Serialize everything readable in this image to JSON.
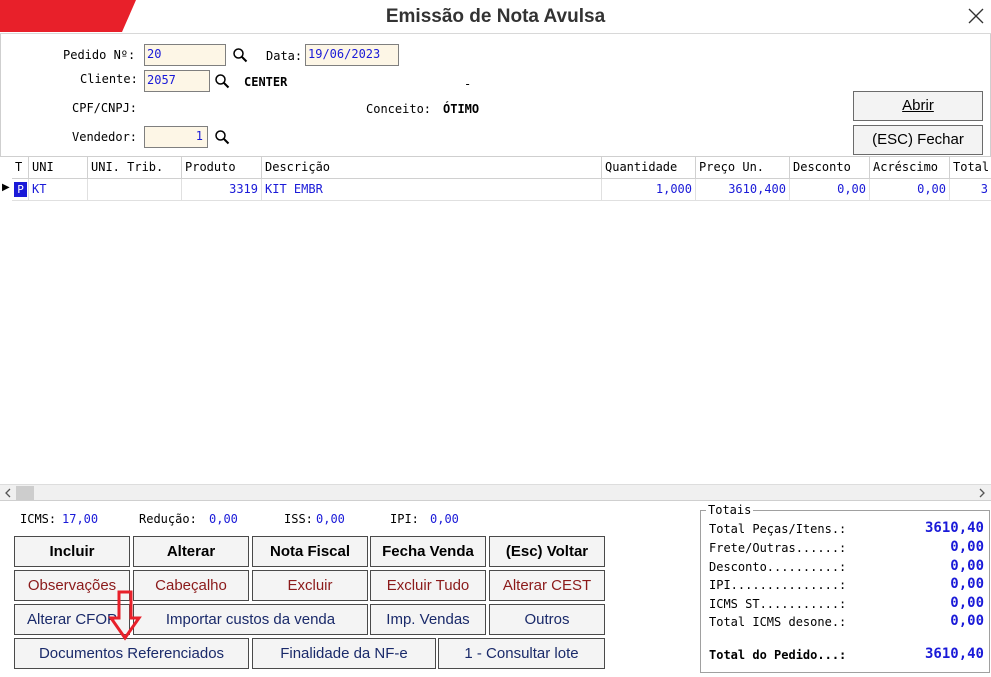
{
  "window": {
    "title": "Emissão de Nota Avulsa",
    "close_icon": "close-icon",
    "accent_color": "#e8202a"
  },
  "header": {
    "pedido_label": "Pedido Nº:",
    "pedido_value": "20",
    "data_label": "Data:",
    "data_value": "19/06/2023",
    "cliente_label": "Cliente:",
    "cliente_value": "2057",
    "cliente_name": "CENTER",
    "cliente_extra": "-",
    "cpf_label": "CPF/CNPJ:",
    "conceito_label": "Conceito:",
    "conceito_value": "ÓTIMO",
    "vendedor_label": "Vendedor:",
    "vendedor_value": "1",
    "abrir_button": "Abrir",
    "fechar_button": "(ESC) Fechar",
    "search_icon": "search-icon"
  },
  "grid": {
    "columns": [
      "T",
      "UNI",
      "UNI. Trib.",
      "Produto",
      "Descrição",
      "Quantidade",
      "Preço Un.",
      "Desconto",
      "Acréscimo",
      "Total"
    ],
    "rows": [
      {
        "indicator": "▶",
        "t": "P",
        "uni": "KT",
        "uni_trib": "",
        "produto": "3319",
        "descricao": "KIT EMBR",
        "quantidade": "1,000",
        "preco": "3610,400",
        "desconto": "0,00",
        "acrescimo": "0,00",
        "total": "3"
      }
    ]
  },
  "taxes": {
    "icms_label": "ICMS:",
    "icms_value": "17,00",
    "reducao_label": "Redução:",
    "reducao_value": "0,00",
    "iss_label": "ISS:",
    "iss_value": "0,00",
    "ipi_label": "IPI:",
    "ipi_value": "0,00"
  },
  "buttons": {
    "incluir": "Incluir",
    "alterar": "Alterar",
    "nota_fiscal": "Nota Fiscal",
    "fecha_venda": "Fecha Venda",
    "voltar": "(Esc) Voltar",
    "observacoes": "Observações",
    "cabecalho": "Cabeçalho",
    "excluir": "Excluir",
    "excluir_tudo": "Excluir Tudo",
    "alterar_cest": "Alterar CEST",
    "alterar_cfop": "Alterar CFOP",
    "importar_custos": "Importar custos da venda",
    "imp_vendas": "Imp. Vendas",
    "outros": "Outros",
    "documentos_referenciados": "Documentos Referenciados",
    "finalidade_nfe": "Finalidade da NF-e",
    "consultar_lote": "1 - Consultar lote"
  },
  "totals": {
    "title": "Totais",
    "items": [
      {
        "label": "Total Peças/Itens.:",
        "value": "3610,40"
      },
      {
        "label": "Frete/Outras......:",
        "value": "0,00"
      },
      {
        "label": "Desconto..........:",
        "value": "0,00"
      },
      {
        "label": "IPI...............:",
        "value": "0,00"
      },
      {
        "label": "ICMS ST...........:",
        "value": "0,00"
      },
      {
        "label": "Total ICMS desone.:",
        "value": "0,00"
      }
    ],
    "total_label": "Total do Pedido...:",
    "total_value": "3610,40"
  },
  "annotation": {
    "arrow_icon": "arrow-down-icon",
    "arrow_color": "#e8202a"
  }
}
